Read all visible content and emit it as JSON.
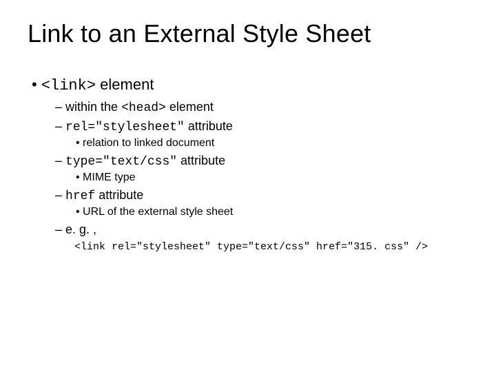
{
  "title": "Link to an External Style Sheet",
  "b1_code": "<link>",
  "b1_text": " element",
  "l2_a_pre": "within the ",
  "l2_a_code": "<head>",
  "l2_a_post": " element",
  "l2_b_code": "rel=\"stylesheet\"",
  "l2_b_post": " attribute",
  "l3_b": "relation to linked document",
  "l2_c_code": "type=\"text/css\"",
  "l2_c_post": " attribute",
  "l3_c": "MIME type",
  "l2_d_code": "href",
  "l2_d_post": " attribute",
  "l3_d": "URL of the external style sheet",
  "l2_e": "e. g. ,",
  "example": "<link rel=\"stylesheet\" type=\"text/css\" href=\"315. css\" />"
}
